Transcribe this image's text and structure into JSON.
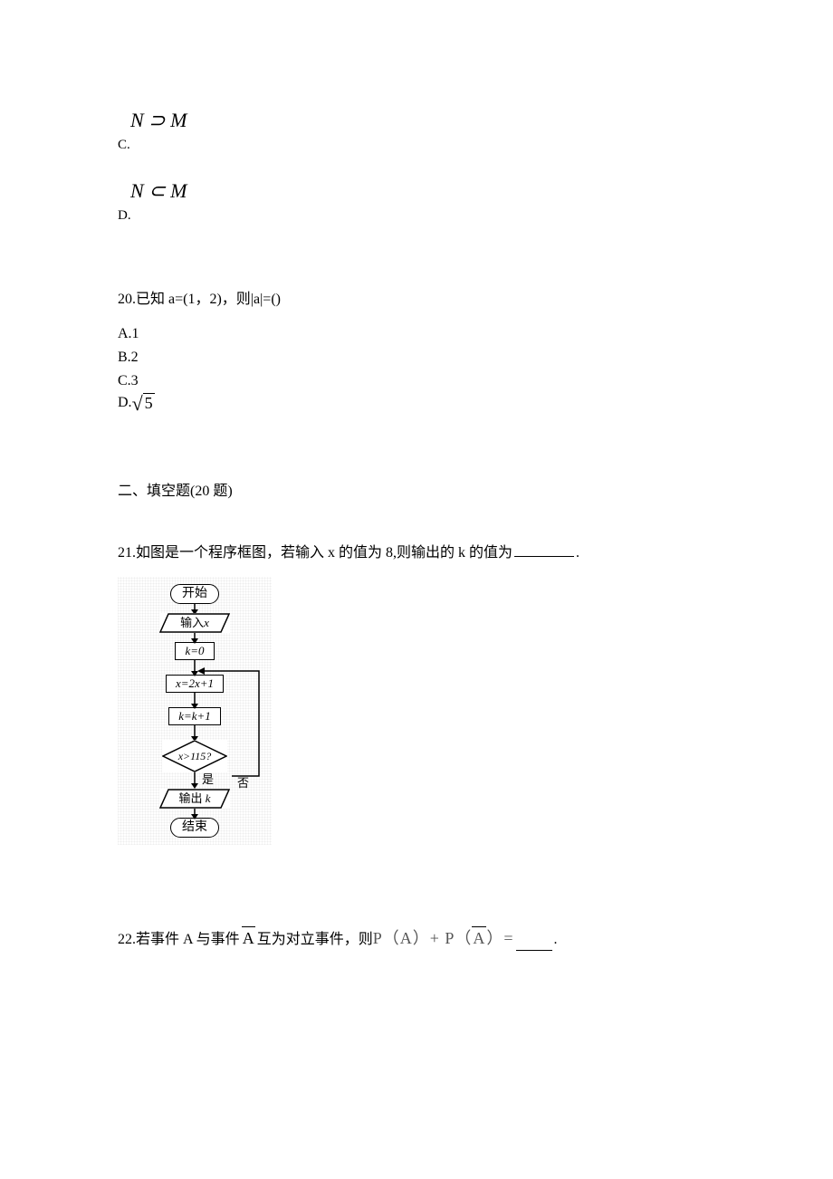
{
  "q19": {
    "c_math": "N ⊃ M",
    "c_letter": "C.",
    "d_math": "N ⊂ M",
    "d_letter": "D."
  },
  "q20": {
    "stem": "20.已知 a=(1，2)，则|a|=()",
    "a": "A.1",
    "b": "B.2",
    "c": "C.3",
    "d_prefix": "D.",
    "d_rad": "5"
  },
  "section2": "二、填空题(20 题)",
  "q21": {
    "stem_pre": "21.如图是一个程序框图，若输入 x 的值为 8,则输出的 k 的值为",
    "stem_post": "."
  },
  "flow": {
    "start": "开始",
    "input_prefix": "输入",
    "input_var": "x",
    "init": "k=0",
    "step1": "x=2x+1",
    "step2": "k=k+1",
    "cond": "x>115?",
    "no": "否",
    "yes": "是",
    "output_prefix": "输出",
    "output_var": "k",
    "end": "结束"
  },
  "q22": {
    "pre": "22.若事件 A 与事件",
    "abar": "A",
    "mid": " 互为对立事件，则",
    "math_p1": "P（A）+ P（",
    "math_abar": "A",
    "math_p2": "）=",
    "post": "."
  }
}
